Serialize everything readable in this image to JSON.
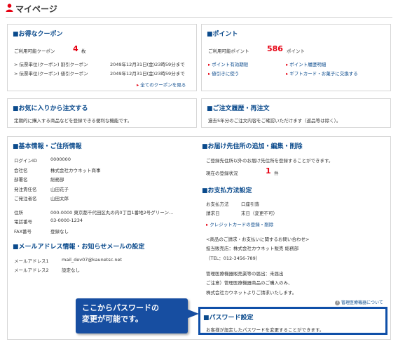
{
  "page": {
    "title": "マイページ"
  },
  "coupon": {
    "title": "■お得なクーポン",
    "available_label": "ご利用可能クーポン",
    "count": "4",
    "unit": "枚",
    "items": [
      {
        "name": "> 伝票単位(クーポン) 割引クーポン",
        "expiry": "2049年12月31日(金)23時59分まで"
      },
      {
        "name": "> 伝票単位(クーポン) 値引クーポン",
        "expiry": "2049年12月31日(金)23時59分まで"
      }
    ],
    "all_link": "全てのクーポンを見る"
  },
  "points": {
    "title": "■ポイント",
    "available_label": "ご利用可能ポイント",
    "value": "586",
    "unit": "ポイント",
    "links": [
      "ポイント有効期限",
      "ポイント履歴明細",
      "値引きに使う",
      "ギフトカード・お菓子に交換する"
    ]
  },
  "favorites": {
    "title": "■お気に入りから注文する",
    "desc": "定期的に購入する商品などを登録できる便利な機能です。"
  },
  "history": {
    "title": "■ご注文履歴・再注文",
    "desc": "過去5年分のご注文内容をご確認いただけます（返品等は除く）。"
  },
  "basic": {
    "title": "■基本情報・ご住所情報",
    "rows": [
      {
        "label": "ログインID",
        "value": "0000000"
      },
      {
        "label": "会社名",
        "value": "株式会社カウネット商事"
      },
      {
        "label": "部署名",
        "value": "総務部"
      },
      {
        "label": "発注責任名",
        "value": "山田花子"
      },
      {
        "label": "ご発注者名",
        "value": "山田太郎"
      }
    ],
    "rows2": [
      {
        "label": "住所",
        "value": "000-0000 東京都千代田区丸の内0丁目1番地2号グリーン…"
      },
      {
        "label": "電話番号",
        "value": "03-0000-1234"
      },
      {
        "label": "FAX番号",
        "value": "登録なし"
      }
    ]
  },
  "mail": {
    "title": "■メールアドレス情報・お知らせメールの設定",
    "rows": [
      {
        "label": "メールアドレス1",
        "value": "mail_dev07@kaunetsc.net"
      },
      {
        "label": "メールアドレス2",
        "value": "設定なし"
      }
    ]
  },
  "delivery": {
    "title": "■お届け先住所の追加・編集・削除",
    "desc": "ご登録先住所以外のお届け先住所を登録することができます。",
    "count_label": "現在の登録状況",
    "count": "1",
    "unit": "件"
  },
  "payment": {
    "title": "■お支払方法設定",
    "rows": [
      {
        "label": "お支払方法",
        "value": "口座引落"
      },
      {
        "label": "請求日",
        "value": "末日（変更不可）"
      }
    ],
    "link": "クレジットカードの登録・削除",
    "inquiry_heading": "<商品のご請求・お支払いに関するお問い合わせ>",
    "inquiry_line1": "担当販売店：株式会社カウネット販売 総務部",
    "inquiry_line2": "（TEL：012-3456-789）",
    "medical_line1": "管理医療機器販売業等の届出：未届出",
    "medical_line2": "ご注意）管理医療機器商品のご購入のみ、",
    "medical_line3": "株式会社カウネットよりご請求いたします。",
    "medical_link": "管理医療機器について"
  },
  "password": {
    "title": "■パスワード設定",
    "desc": "お客様が設定したパスワードを変更することができます。"
  },
  "callout": {
    "line1": "ここからパスワードの",
    "line2": "変更が可能です。"
  }
}
